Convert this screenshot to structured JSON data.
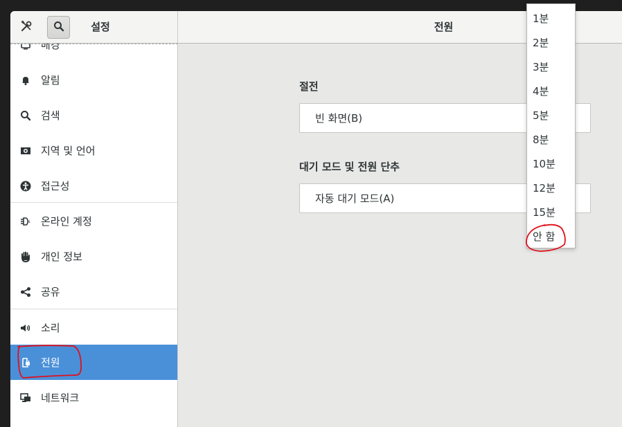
{
  "header": {
    "tools_icon": "tools-icon",
    "search_icon": "search-icon",
    "app_title": "설정",
    "page_title": "전원"
  },
  "sidebar": {
    "items": [
      {
        "label": "배경",
        "icon": "background-icon"
      },
      {
        "label": "알림",
        "icon": "bell-icon"
      },
      {
        "label": "검색",
        "icon": "search-icon"
      },
      {
        "label": "지역 및 언어",
        "icon": "flag-icon"
      },
      {
        "label": "접근성",
        "icon": "accessibility-icon"
      },
      {
        "label": "온라인 계정",
        "icon": "online-accounts-icon"
      },
      {
        "label": "개인 정보",
        "icon": "hand-icon"
      },
      {
        "label": "공유",
        "icon": "share-icon"
      },
      {
        "label": "소리",
        "icon": "speaker-icon"
      },
      {
        "label": "전원",
        "icon": "power-plug-icon",
        "selected": true
      },
      {
        "label": "네트워크",
        "icon": "network-icon"
      }
    ]
  },
  "main": {
    "sections": [
      {
        "title": "절전",
        "row_label": "빈 화면(B)"
      },
      {
        "title": "대기 모드 및 전원 단추",
        "row_label": "자동 대기 모드(A)"
      }
    ]
  },
  "popover": {
    "options": [
      "1분",
      "2분",
      "3분",
      "4분",
      "5분",
      "8분",
      "10분",
      "12분",
      "15분",
      "안 함"
    ]
  },
  "colors": {
    "selected_bg": "#4a90d9",
    "annotation": "#e0101a"
  }
}
